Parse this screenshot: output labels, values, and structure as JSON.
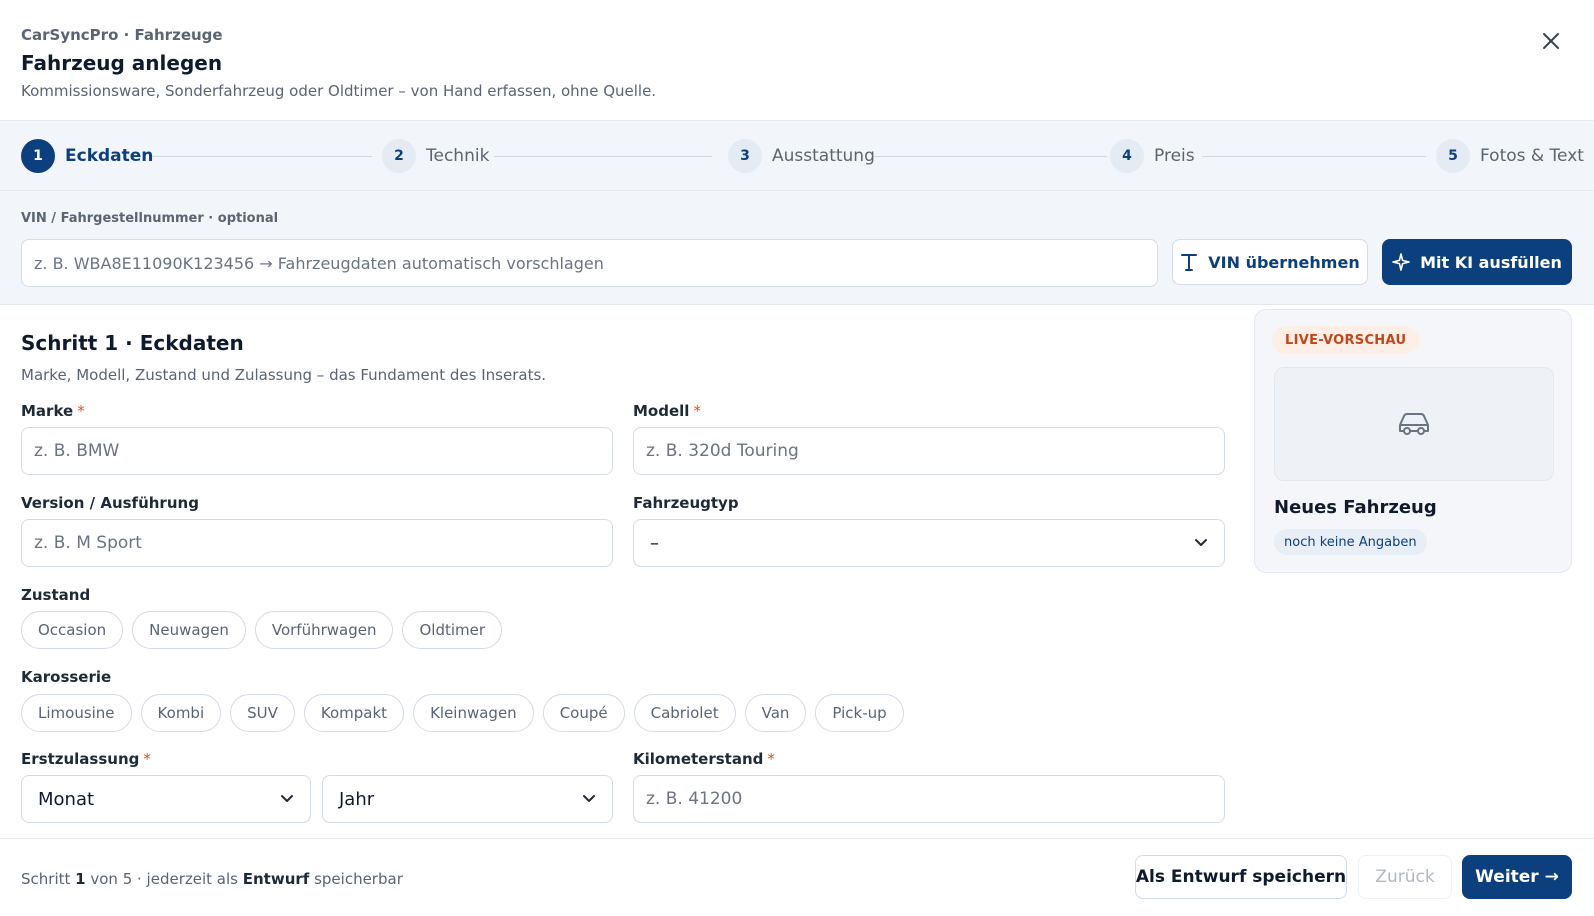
{
  "header": {
    "kicker": "CarSyncPro · Fahrzeuge",
    "title": "Fahrzeug anlegen",
    "subtitle": "Kommissionsware, Sonderfahrzeug oder Oldtimer – von Hand erfassen, ohne Quelle.",
    "close_icon": "close-icon"
  },
  "stepper": {
    "active_step": 1,
    "steps": [
      {
        "number": "1",
        "label": "Eckdaten"
      },
      {
        "number": "2",
        "label": "Technik"
      },
      {
        "number": "3",
        "label": "Ausstattung"
      },
      {
        "number": "4",
        "label": "Preis"
      },
      {
        "number": "5",
        "label": "Fotos & Text"
      }
    ]
  },
  "vin": {
    "label": "VIN / Fahrgestellnummer · optional",
    "placeholder": "z. B. WBA8E11090K123456 → Fahrzeugdaten automatisch vorschlagen",
    "value": "",
    "adopt_button": "VIN übernehmen",
    "adopt_icon": "text-cursor-icon",
    "ai_button": "Mit KI ausfüllen",
    "ai_icon": "sparkle-icon"
  },
  "form": {
    "section_title": "Schritt 1 · Eckdaten",
    "section_desc": "Marke, Modell, Zustand und Zulassung – das Fundament des Inserats.",
    "required_marker": "*",
    "make": {
      "label": "Marke",
      "placeholder": "z. B. BMW",
      "value": ""
    },
    "model": {
      "label": "Modell",
      "placeholder": "z. B. 320d Touring",
      "value": ""
    },
    "version": {
      "label": "Version / Ausführung",
      "placeholder": "z. B. M Sport",
      "value": ""
    },
    "vehicle_type": {
      "label": "Fahrzeugtyp",
      "selected": "–"
    },
    "condition": {
      "label": "Zustand",
      "options": [
        "Occasion",
        "Neuwagen",
        "Vorführwagen",
        "Oldtimer"
      ]
    },
    "body": {
      "label": "Karosserie",
      "options": [
        "Limousine",
        "Kombi",
        "SUV",
        "Kompakt",
        "Kleinwagen",
        "Coupé",
        "Cabriolet",
        "Van",
        "Pick-up"
      ]
    },
    "first_registration": {
      "label": "Erstzulassung",
      "month": "Monat",
      "year": "Jahr"
    },
    "mileage": {
      "label": "Kilometerstand",
      "placeholder": "z. B. 41200",
      "value": ""
    }
  },
  "preview": {
    "badge": "LIVE-VORSCHAU",
    "image_icon": "car-icon",
    "name": "Neues Fahrzeug",
    "status": "noch keine Angaben"
  },
  "footer": {
    "step_prefix": "Schritt",
    "step_current": "1",
    "step_middle": "von 5 · jederzeit als",
    "draft_word": "Entwurf",
    "step_suffix": "speicherbar",
    "draft_button": "Als Entwurf speichern",
    "back_button": "Zurück",
    "next_button": "Weiter →"
  },
  "colors": {
    "brand": "#0c3f7d",
    "required": "#d9532b",
    "badge_text": "#c2461d",
    "band_background": "#f2f5f9"
  }
}
